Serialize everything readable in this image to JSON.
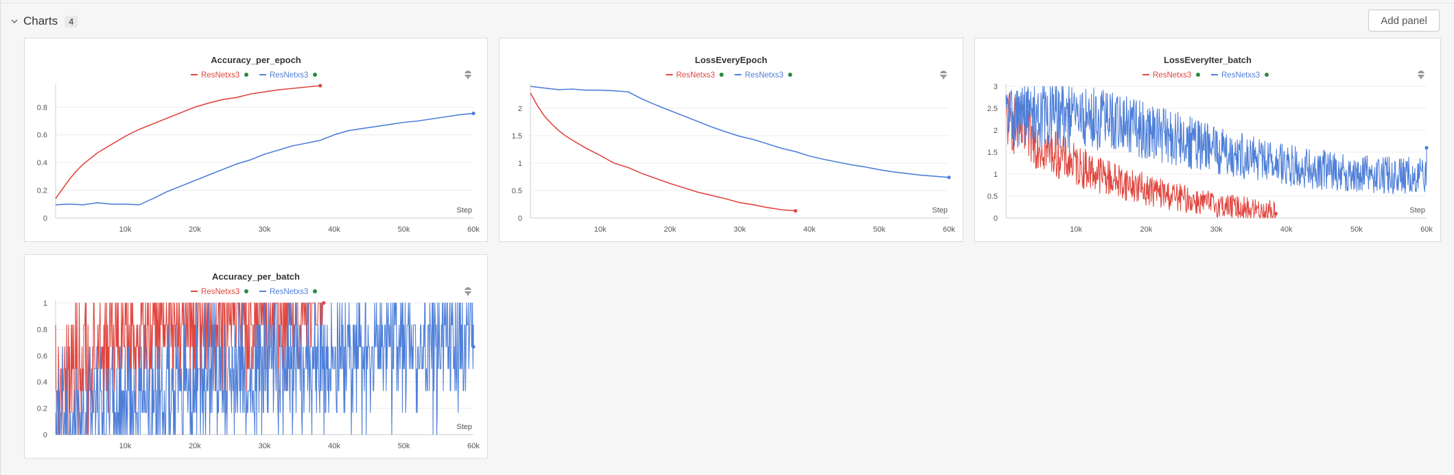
{
  "section": {
    "title": "Charts",
    "count": "4",
    "add_panel_label": "Add panel"
  },
  "colors": {
    "red": "#e0463f",
    "blue": "#4e7fd9",
    "run_dot": "#2b8a3e",
    "grid": "#ececec",
    "axis_text": "#555555"
  },
  "chart_data": [
    {
      "type": "line",
      "title": "Accuracy_per_epoch",
      "xlabel": "Step",
      "ylabel": "",
      "grid": true,
      "legend_position": "top-center",
      "xlim": [
        0,
        60000
      ],
      "ylim": [
        0,
        0.95
      ],
      "xticks": [
        "10k",
        "20k",
        "30k",
        "40k",
        "50k",
        "60k"
      ],
      "yticks": [
        "0",
        "0.2",
        "0.4",
        "0.6",
        "0.8"
      ],
      "series": [
        {
          "name": "ResNetxs3",
          "color": "#e0463f",
          "x": [
            0,
            1000,
            2000,
            3000,
            4000,
            5000,
            6000,
            8000,
            10000,
            12000,
            14000,
            16000,
            18000,
            20000,
            22000,
            24000,
            26000,
            28000,
            30000,
            32000,
            34000,
            36000,
            38000
          ],
          "y": [
            0.14,
            0.21,
            0.28,
            0.34,
            0.39,
            0.43,
            0.47,
            0.53,
            0.59,
            0.64,
            0.68,
            0.72,
            0.76,
            0.8,
            0.83,
            0.855,
            0.87,
            0.895,
            0.91,
            0.925,
            0.935,
            0.945,
            0.955
          ]
        },
        {
          "name": "ResNetxs3",
          "color": "#4e7fd9",
          "x": [
            0,
            2000,
            4000,
            6000,
            8000,
            10000,
            12000,
            14000,
            16000,
            18000,
            20000,
            22000,
            24000,
            26000,
            28000,
            30000,
            32000,
            34000,
            36000,
            38000,
            40000,
            42000,
            44000,
            46000,
            48000,
            50000,
            52000,
            54000,
            56000,
            58000,
            60000
          ],
          "y": [
            0.095,
            0.1,
            0.095,
            0.11,
            0.1,
            0.1,
            0.095,
            0.14,
            0.19,
            0.23,
            0.27,
            0.31,
            0.35,
            0.39,
            0.42,
            0.46,
            0.49,
            0.52,
            0.54,
            0.56,
            0.6,
            0.63,
            0.645,
            0.66,
            0.675,
            0.69,
            0.7,
            0.715,
            0.73,
            0.745,
            0.755
          ]
        }
      ]
    },
    {
      "type": "line",
      "title": "LossEveryEpoch",
      "xlabel": "Step",
      "ylabel": "",
      "grid": true,
      "legend_position": "top-center",
      "xlim": [
        0,
        60000
      ],
      "ylim": [
        0,
        2.4
      ],
      "xticks": [
        "10k",
        "20k",
        "30k",
        "40k",
        "50k",
        "60k"
      ],
      "yticks": [
        "0",
        "0.5",
        "1",
        "1.5",
        "2"
      ],
      "series": [
        {
          "name": "ResNetxs3",
          "color": "#e0463f",
          "x": [
            0,
            1000,
            2000,
            3000,
            4000,
            5000,
            6000,
            8000,
            10000,
            12000,
            14000,
            16000,
            18000,
            20000,
            22000,
            24000,
            26000,
            28000,
            30000,
            32000,
            34000,
            36000,
            38000
          ],
          "y": [
            2.28,
            2.05,
            1.86,
            1.72,
            1.6,
            1.5,
            1.42,
            1.27,
            1.14,
            1.0,
            0.92,
            0.81,
            0.72,
            0.63,
            0.55,
            0.47,
            0.41,
            0.35,
            0.28,
            0.24,
            0.19,
            0.15,
            0.13
          ]
        },
        {
          "name": "ResNetxs3",
          "color": "#4e7fd9",
          "x": [
            0,
            2000,
            4000,
            6000,
            8000,
            10000,
            12000,
            14000,
            16000,
            18000,
            20000,
            22000,
            24000,
            26000,
            28000,
            30000,
            32000,
            34000,
            36000,
            38000,
            40000,
            42000,
            44000,
            46000,
            48000,
            50000,
            52000,
            54000,
            56000,
            58000,
            60000
          ],
          "y": [
            2.4,
            2.37,
            2.34,
            2.35,
            2.33,
            2.33,
            2.32,
            2.3,
            2.17,
            2.06,
            1.96,
            1.86,
            1.76,
            1.66,
            1.57,
            1.49,
            1.43,
            1.35,
            1.27,
            1.21,
            1.13,
            1.07,
            1.02,
            0.97,
            0.93,
            0.88,
            0.84,
            0.81,
            0.78,
            0.76,
            0.74
          ]
        }
      ]
    },
    {
      "type": "line",
      "title": "LossEveryIter_batch",
      "xlabel": "Step",
      "ylabel": "",
      "grid": true,
      "legend_position": "top-center",
      "xlim": [
        0,
        60000
      ],
      "ylim": [
        0,
        3
      ],
      "xticks": [
        "10k",
        "20k",
        "30k",
        "40k",
        "50k",
        "60k"
      ],
      "yticks": [
        "0",
        "0.5",
        "1",
        "1.5",
        "2",
        "2.5",
        "3"
      ],
      "noisy": true,
      "series": [
        {
          "name": "ResNetxs3",
          "color": "#e0463f",
          "x_end": 38500,
          "trend_x": [
            0,
            2000,
            5000,
            10000,
            15000,
            20000,
            25000,
            30000,
            35000,
            38500
          ],
          "trend_y": [
            2.3,
            2.0,
            1.65,
            1.2,
            0.9,
            0.65,
            0.45,
            0.3,
            0.2,
            0.15
          ],
          "noise_amplitude": 0.55,
          "last_value": 0.1
        },
        {
          "name": "ResNetxs3",
          "color": "#4e7fd9",
          "x_end": 60000,
          "trend_x": [
            0,
            5000,
            10000,
            14000,
            20000,
            30000,
            40000,
            50000,
            60000
          ],
          "trend_y": [
            2.35,
            2.35,
            2.3,
            2.25,
            2.0,
            1.55,
            1.2,
            1.0,
            0.95
          ],
          "noise_amplitude": 0.55,
          "last_value": 1.6
        }
      ]
    },
    {
      "type": "line",
      "title": "Accuracy_per_batch",
      "xlabel": "Step",
      "ylabel": "",
      "grid": true,
      "legend_position": "top-center",
      "xlim": [
        0,
        60000
      ],
      "ylim": [
        0,
        1
      ],
      "xticks": [
        "10k",
        "20k",
        "30k",
        "40k",
        "50k",
        "60k"
      ],
      "yticks": [
        "0",
        "0.2",
        "0.4",
        "0.6",
        "0.8",
        "1"
      ],
      "noisy": true,
      "discrete_levels": [
        0,
        0.167,
        0.333,
        0.5,
        0.667,
        0.833,
        1
      ],
      "series": [
        {
          "name": "ResNetxs3",
          "color": "#e0463f",
          "x_end": 38500,
          "trend_x": [
            0,
            3000,
            8000,
            15000,
            25000,
            38500
          ],
          "trend_y": [
            0.25,
            0.45,
            0.7,
            0.8,
            0.88,
            0.95
          ],
          "last_value": 1
        },
        {
          "name": "ResNetxs3",
          "color": "#4e7fd9",
          "x_end": 60000,
          "trend_x": [
            0,
            10000,
            20000,
            30000,
            40000,
            50000,
            60000
          ],
          "trend_y": [
            0.1,
            0.2,
            0.4,
            0.5,
            0.6,
            0.7,
            0.75
          ],
          "last_value": 0.667
        }
      ]
    }
  ]
}
